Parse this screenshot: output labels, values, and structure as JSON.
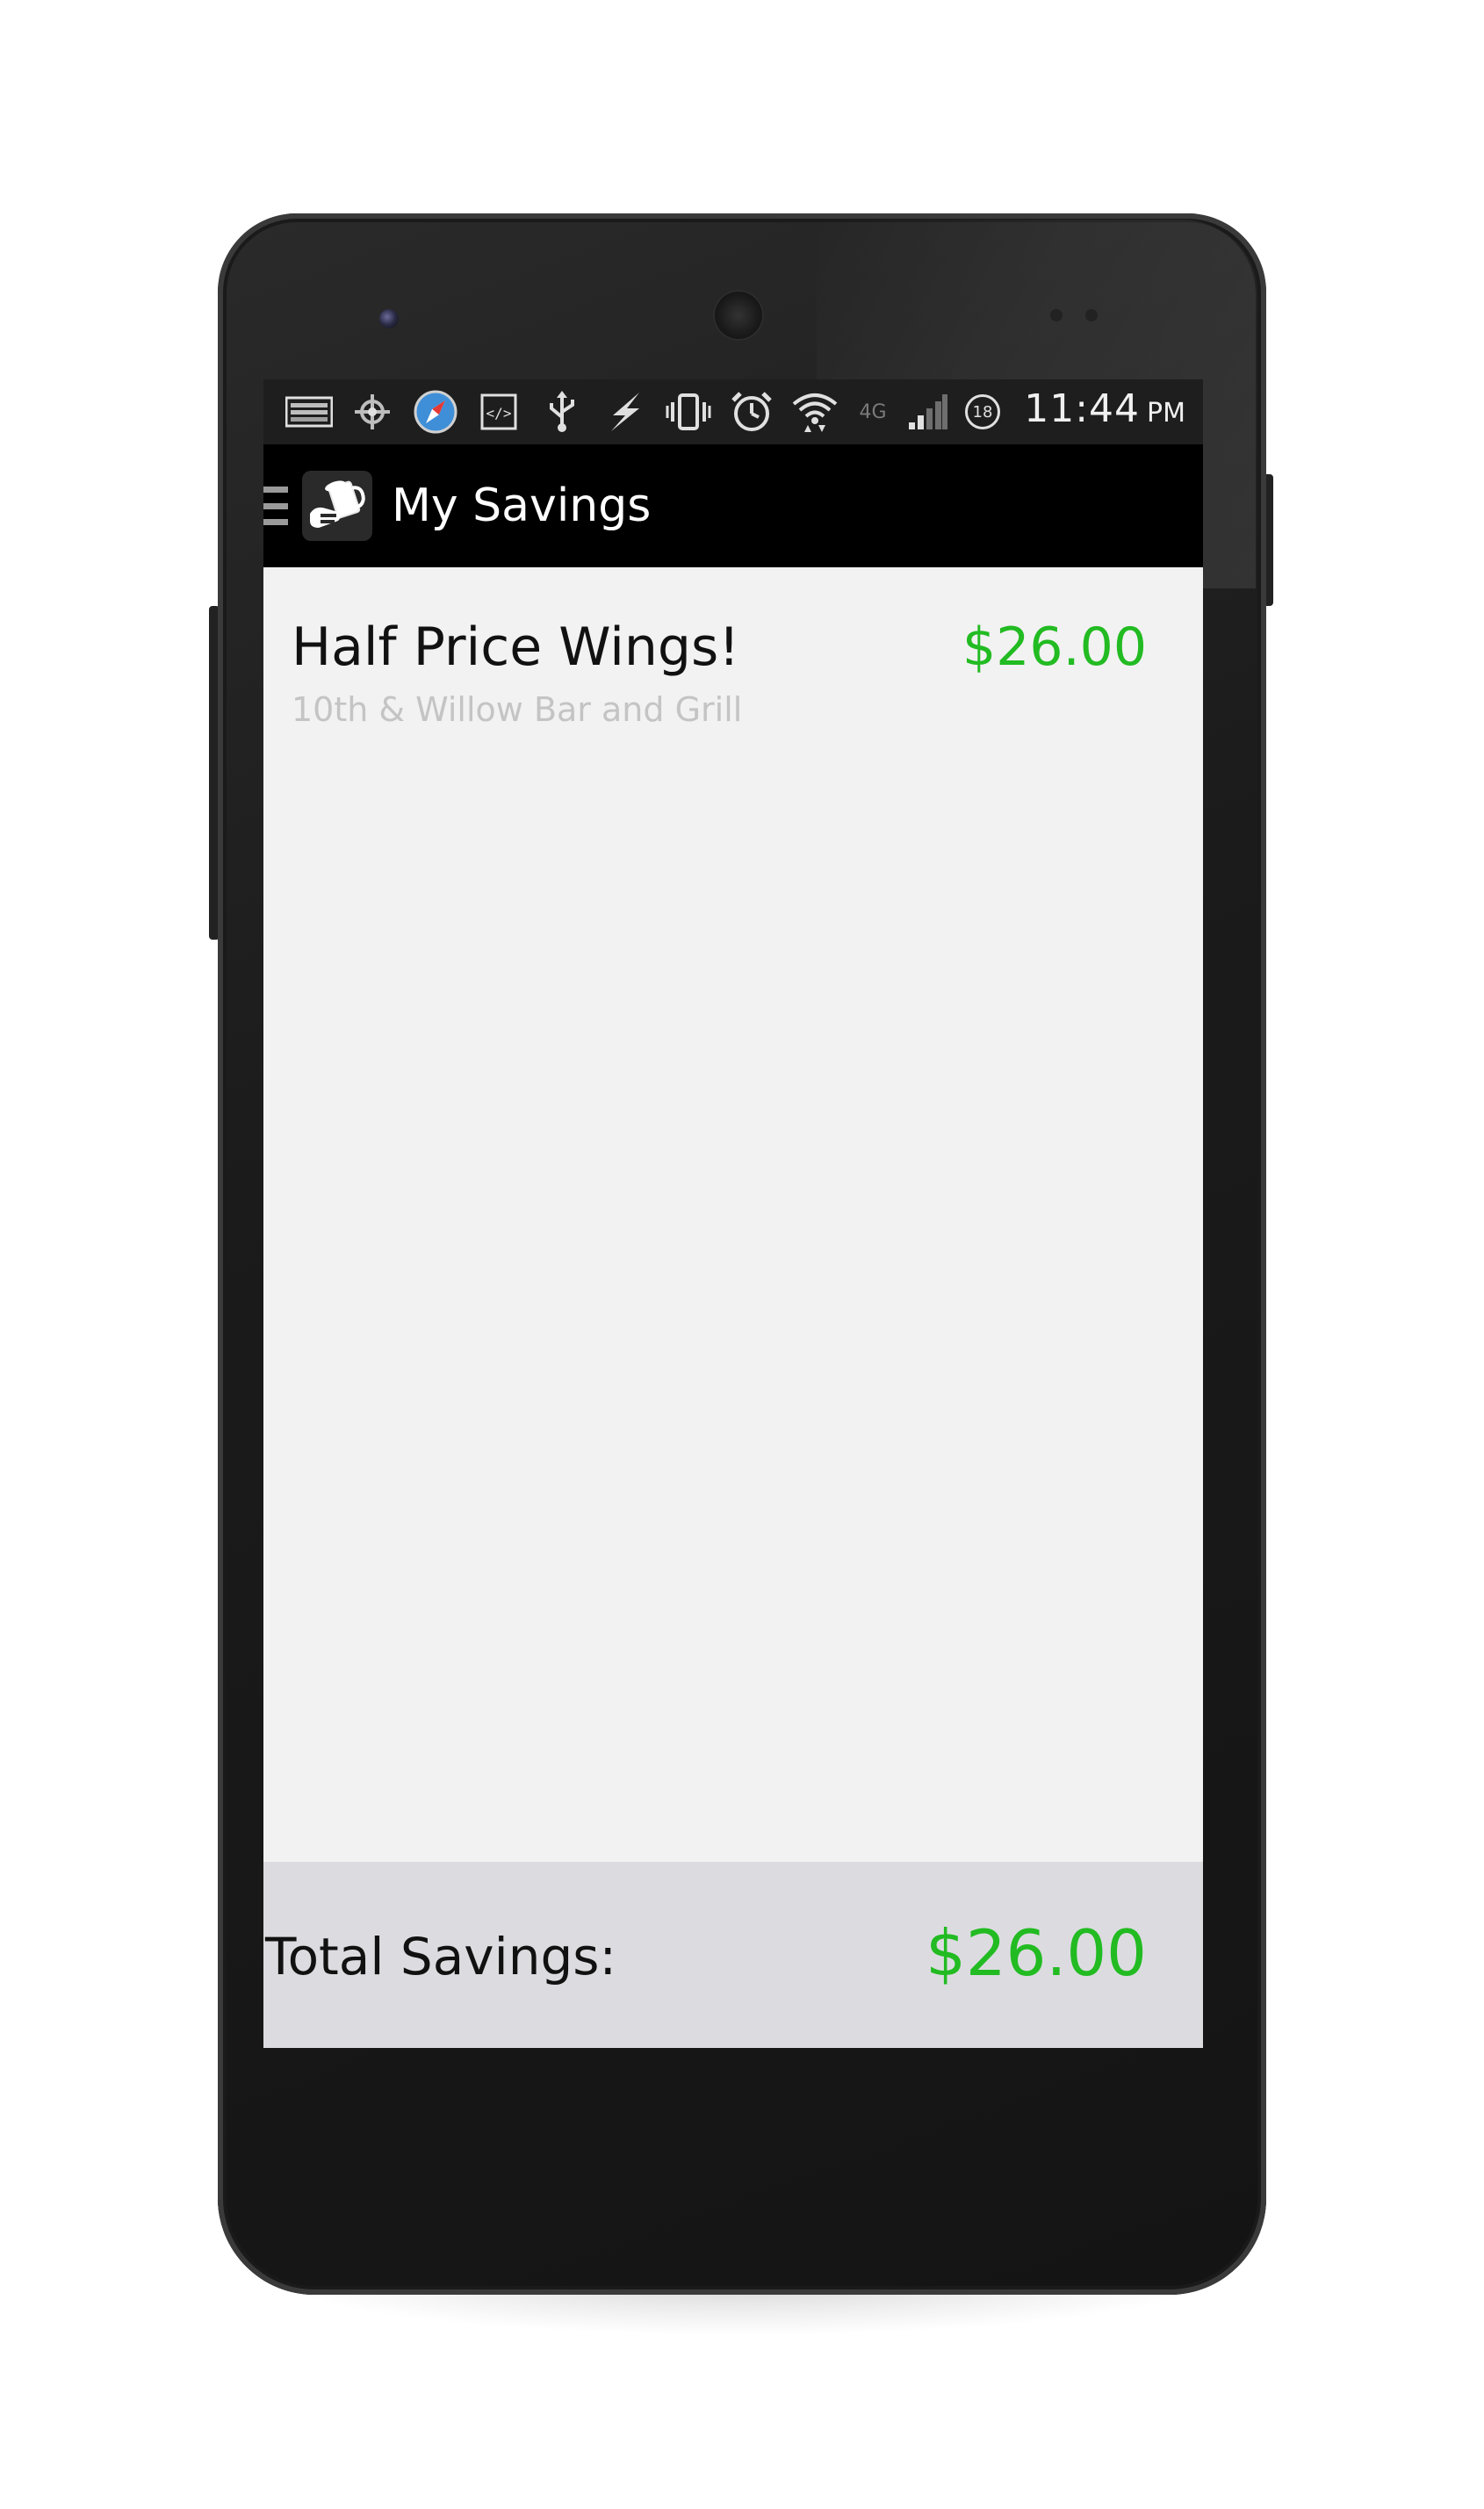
{
  "status_bar": {
    "icons": [
      "keyboard-icon",
      "gps-icon",
      "compass-icon",
      "code-icon",
      "usb-icon",
      "flash-icon",
      "vibrate-icon",
      "alarm-icon",
      "wifi-icon",
      "network-4g-icon",
      "signal-icon",
      "notification-count-icon"
    ],
    "network_type": "4G",
    "notification_count": "18",
    "time": "11:44",
    "ampm": "PM"
  },
  "action_bar": {
    "drawer_icon": "menu-icon",
    "logo_icon": "beer-mug-icon",
    "title": "My Savings"
  },
  "savings_list": [
    {
      "title": "Half Price Wings!",
      "venue": "10th & Willow Bar and Grill",
      "amount": "$26.00"
    }
  ],
  "footer": {
    "total_label": "Total Savings:",
    "total_value": "$26.00"
  },
  "colors": {
    "accent_green": "#22bb22",
    "action_bar": "#000000",
    "status_bar": "#1e1e1e",
    "content_bg": "#f2f2f2",
    "footer_bg": "#dcdce0",
    "secondary_text": "#c4c4c4"
  }
}
